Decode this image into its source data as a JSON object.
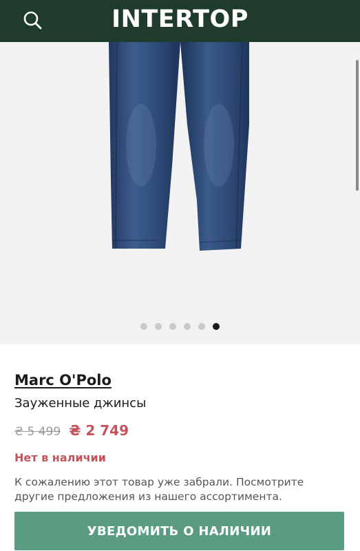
{
  "header": {
    "logo_text": "INTERTOP",
    "search_icon": "search-icon",
    "background": "#1f3b2c"
  },
  "gallery": {
    "image": "dark-blue-slim-jeans-photo",
    "total_images": 6,
    "active_index": 6
  },
  "product": {
    "brand": "Marc O'Polo",
    "name": "Зауженные джинсы",
    "old_price": "₴ 5 499",
    "new_price": "₴ 2 749",
    "availability": "Нет в наличии",
    "notice": "К сожалению этот товар уже забрали. Посмотрите другие предложения из нашего ассортимента."
  },
  "actions": {
    "notify_label": "УВЕДОМИТЬ О НАЛИЧИИ",
    "accent": "#5a9c82",
    "sale_color": "#c4535a"
  }
}
